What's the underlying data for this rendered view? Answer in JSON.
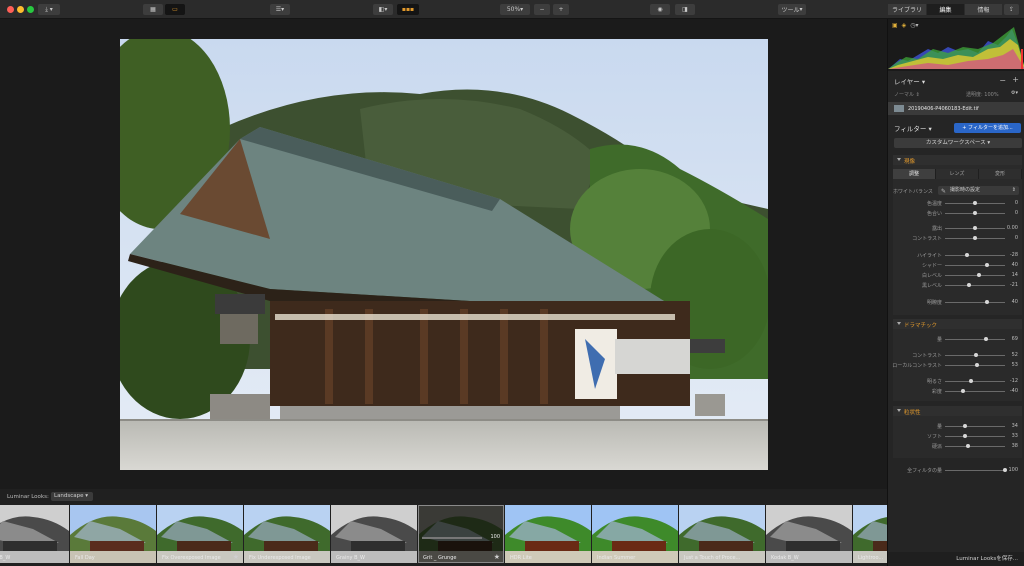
{
  "toolbar": {
    "zoom": "50%",
    "zoom_minus": "−",
    "zoom_plus": "+",
    "tools_label": "ツール",
    "tabs": [
      "ライブラリ",
      "編集",
      "情報"
    ],
    "colors": {
      "accent": "#2a66c8",
      "bg": "#2b2b2b"
    }
  },
  "looks": {
    "label": "Luminar Looks:",
    "category": "Landscape",
    "save_label": "Luminar Looksを保存...",
    "items": [
      {
        "label": "Airy B_W",
        "style": "bw"
      },
      {
        "label": "Fall Day",
        "style": "fall"
      },
      {
        "label": "Fix Overexposed Image",
        "style": "color",
        "star": "★"
      },
      {
        "label": "Fix Underexposed Image",
        "style": "color"
      },
      {
        "label": "Grainy B_W",
        "style": "bw"
      },
      {
        "label": "Grit _ Grunge",
        "style": "dark",
        "selected": true,
        "star": "★",
        "amount": "100"
      },
      {
        "label": "HDR Lite",
        "style": "vivid"
      },
      {
        "label": "Indian Summer",
        "style": "vivid"
      },
      {
        "label": "Just a Touch of Proce...",
        "style": "color"
      },
      {
        "label": "Kodak B_W",
        "style": "bw"
      },
      {
        "label": "Lightroo...",
        "style": "color"
      }
    ]
  },
  "panel": {
    "layers_title": "レイヤー",
    "layer_blend": "ノーマル",
    "opacity_label": "透明度: 100%",
    "layer_name": "20190406-P4060183-Edit.tif",
    "filters_title": "フィルター",
    "add_filter": "+ フィルターを追加...",
    "workspace": "カスタムワークスペース",
    "develop": {
      "title": "現像",
      "tabs": [
        "調整",
        "レンズ",
        "変形"
      ],
      "wb_label": "ホワイトバランス",
      "wb_value": "撮影時の設定",
      "sliders": [
        {
          "label": "色温度",
          "value": "0",
          "level": 0.5
        },
        {
          "label": "色合い",
          "value": "0",
          "level": 0.5
        },
        {
          "label": "露出",
          "value": "0.00",
          "level": 0.5
        },
        {
          "label": "コントラスト",
          "value": "0",
          "level": 0.5
        },
        {
          "label": "ハイライト",
          "value": "-28",
          "level": 0.36
        },
        {
          "label": "シャドー",
          "value": "40",
          "level": 0.7
        },
        {
          "label": "白レベル",
          "value": "14",
          "level": 0.57
        },
        {
          "label": "黒レベル",
          "value": "-21",
          "level": 0.4
        },
        {
          "label": "明瞭度",
          "value": "40",
          "level": 0.7
        }
      ]
    },
    "dramatic": {
      "title": "ドラマチック",
      "sliders": [
        {
          "label": "量",
          "value": "69",
          "level": 0.69
        },
        {
          "label": "コントラスト",
          "value": "52",
          "level": 0.52
        },
        {
          "label": "ローカルコントラスト",
          "value": "53",
          "level": 0.53
        },
        {
          "label": "明るさ",
          "value": "-12",
          "level": 0.44
        },
        {
          "label": "彩度",
          "value": "-40",
          "level": 0.3
        }
      ]
    },
    "grain": {
      "title": "粒状性",
      "sliders": [
        {
          "label": "量",
          "value": "34",
          "level": 0.34
        },
        {
          "label": "ソフト",
          "value": "33",
          "level": 0.33
        },
        {
          "label": "硬派",
          "value": "38",
          "level": 0.38
        }
      ]
    },
    "filter_amount": {
      "label": "全フィルタの量",
      "value": "100",
      "level": 1.0
    }
  }
}
